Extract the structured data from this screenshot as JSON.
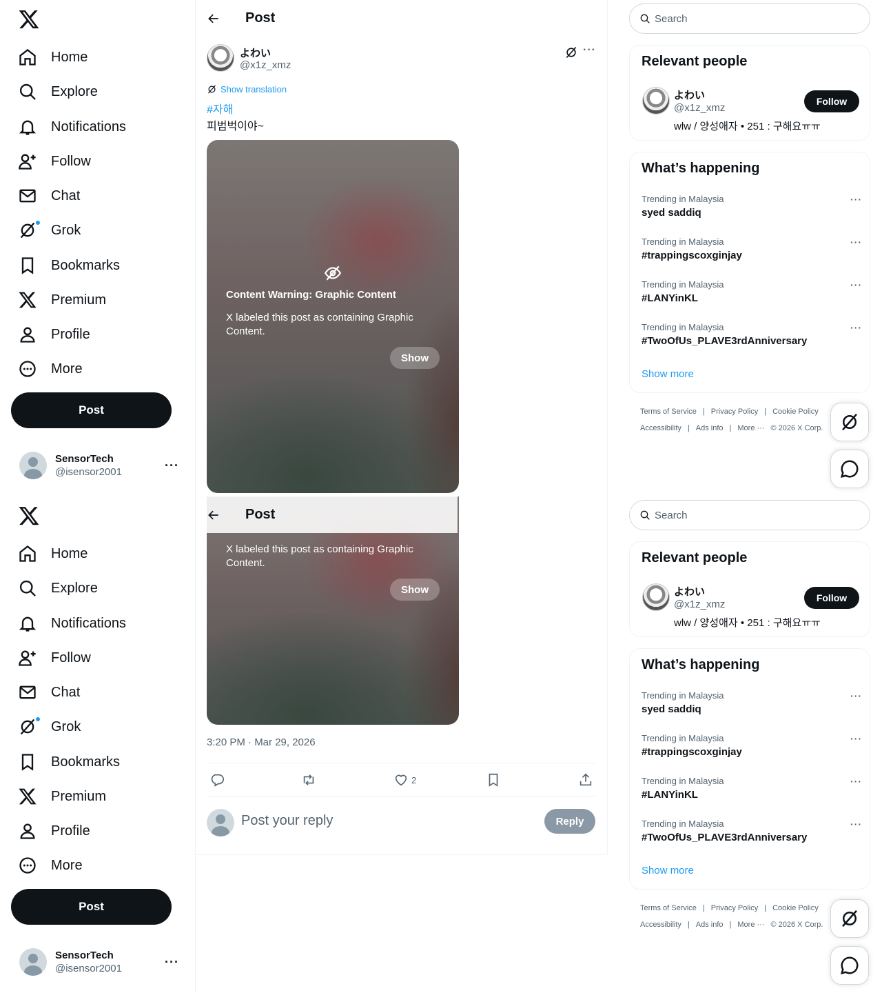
{
  "nav": {
    "items": [
      {
        "label": "Home",
        "icon": "home-icon"
      },
      {
        "label": "Explore",
        "icon": "search-icon"
      },
      {
        "label": "Notifications",
        "icon": "bell-icon"
      },
      {
        "label": "Follow",
        "icon": "person-add-icon"
      },
      {
        "label": "Chat",
        "icon": "envelope-icon"
      },
      {
        "label": "Grok",
        "icon": "grok-icon"
      },
      {
        "label": "Bookmarks",
        "icon": "bookmark-icon"
      },
      {
        "label": "Premium",
        "icon": "x-logo-icon"
      },
      {
        "label": "Profile",
        "icon": "person-icon"
      },
      {
        "label": "More",
        "icon": "more-circle-icon"
      }
    ],
    "post_button": "Post"
  },
  "account": {
    "name": "SensorTech",
    "handle": "@isensor2001",
    "more": "···"
  },
  "header": {
    "title": "Post"
  },
  "post": {
    "author_name": "よわい",
    "author_handle": "@x1z_xmz",
    "more": "···",
    "show_translation": "Show translation",
    "hashtag": "#자해",
    "text": "피범벅이야~",
    "content_warning": {
      "title": "Content Warning: Graphic Content",
      "description": "X labeled this post as containing Graphic Content.",
      "show_button": "Show"
    },
    "timestamp": "3:20 PM · Mar 29, 2026",
    "like_count": "2"
  },
  "reply": {
    "placeholder": "Post your reply",
    "button": "Reply"
  },
  "sidebar": {
    "search_placeholder": "Search",
    "relevant_people": {
      "title": "Relevant people",
      "person": {
        "name": "よわい",
        "handle": "@x1z_xmz",
        "bio": "wlw / 양성애자 • 251 : 구해요ㅠㅠ",
        "follow": "Follow"
      }
    },
    "whats_happening": {
      "title": "What’s happening",
      "trends": [
        {
          "context": "Trending in Malaysia",
          "name": "syed saddiq"
        },
        {
          "context": "Trending in Malaysia",
          "name": "#trappingscoxginjay"
        },
        {
          "context": "Trending in Malaysia",
          "name": "#LANYinKL"
        },
        {
          "context": "Trending in Malaysia",
          "name": "#TwoOfUs_PLAVE3rdAnniversary"
        }
      ],
      "trend_more": "···",
      "show_more": "Show more"
    },
    "footer": {
      "line1": [
        "Terms of Service",
        "|",
        "Privacy Policy",
        "|",
        "Cookie Policy"
      ],
      "line2": [
        "Accessibility",
        "|",
        "Ads info",
        "|",
        "More ···",
        "© 2026 X Corp."
      ]
    }
  }
}
